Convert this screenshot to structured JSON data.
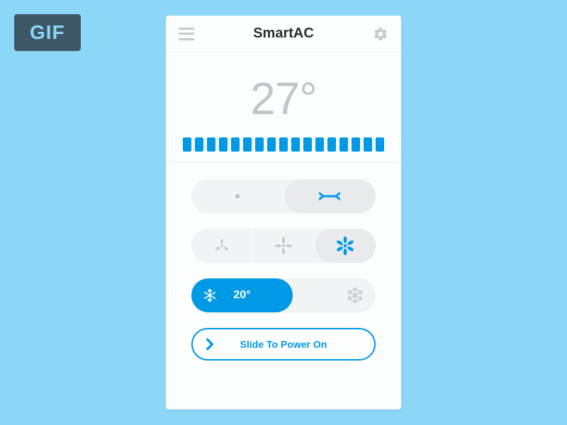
{
  "badge": {
    "label": "GIF"
  },
  "header": {
    "title": "SmartAC"
  },
  "temperature": {
    "current_display": "27°",
    "tick_count": 17
  },
  "swing": {
    "options": [
      "fixed",
      "oscillate"
    ],
    "active_index": 1
  },
  "fan": {
    "options": [
      "low",
      "medium",
      "high"
    ],
    "active_index": 2
  },
  "target": {
    "value_display": "20°"
  },
  "power": {
    "label": "Slide To Power On"
  },
  "colors": {
    "accent": "#0099e5",
    "bg": "#8cd7f7",
    "muted": "#c6cbce"
  }
}
